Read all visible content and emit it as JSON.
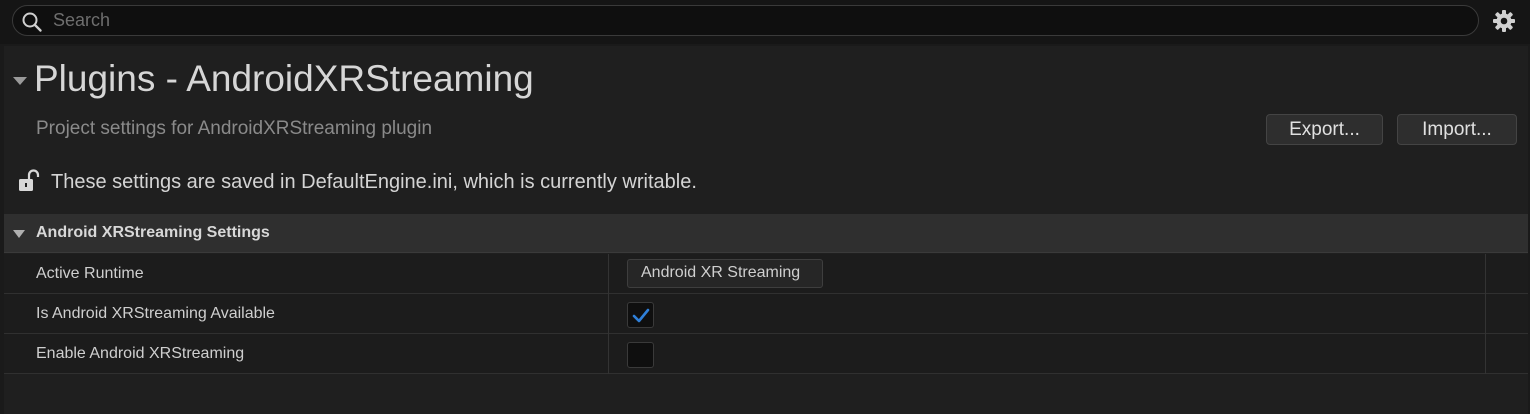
{
  "search": {
    "placeholder": "Search",
    "value": ""
  },
  "header": {
    "title": "Plugins - AndroidXRStreaming",
    "subtitle": "Project settings for AndroidXRStreaming plugin",
    "export_label": "Export...",
    "import_label": "Import...",
    "notice": "These settings are saved in DefaultEngine.ini, which is currently writable."
  },
  "section": {
    "title": "Android XRStreaming Settings",
    "properties": [
      {
        "name": "Active Runtime",
        "type": "combo",
        "value": "Android XR Streaming"
      },
      {
        "name": "Is Android XRStreaming Available",
        "type": "checkbox",
        "checked": true
      },
      {
        "name": "Enable Android XRStreaming",
        "type": "checkbox",
        "checked": false
      }
    ]
  },
  "colors": {
    "background": "#1a1a1a",
    "panel": "#1f1f1f",
    "section_header": "#2f2f2f",
    "check_accent": "#2f7fd8"
  },
  "icons": {
    "search": "search-icon",
    "settings": "gear-icon",
    "lock": "unlocked-lock-icon",
    "collapse": "triangle-down-icon",
    "check": "checkmark-icon"
  }
}
